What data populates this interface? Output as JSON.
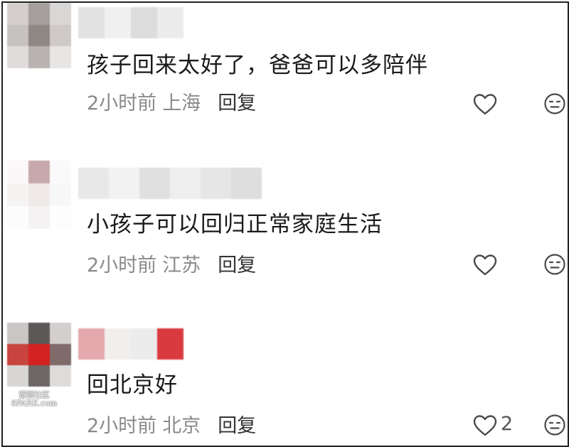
{
  "comments": [
    {
      "text": "孩子回来太好了，爸爸可以多陪伴",
      "time": "2小时前",
      "location": "上海",
      "reply_label": "回复",
      "like_count": ""
    },
    {
      "text": "小孩子可以回归正常家庭生活",
      "time": "2小时前",
      "location": "江苏",
      "reply_label": "回复",
      "like_count": ""
    },
    {
      "text": "回北京好",
      "time": "2小时前",
      "location": "北京",
      "reply_label": "回复",
      "like_count": "2"
    }
  ],
  "icons": {
    "like": "heart-icon",
    "dislike": "neutral-face-icon"
  },
  "watermark": {
    "line1": "留园社区",
    "line2": "6PARK.com"
  },
  "colors": {
    "meta_text": "#8a8a8a",
    "comment_text": "#1a1a1a",
    "icon_stroke": "#4a4a4a"
  }
}
